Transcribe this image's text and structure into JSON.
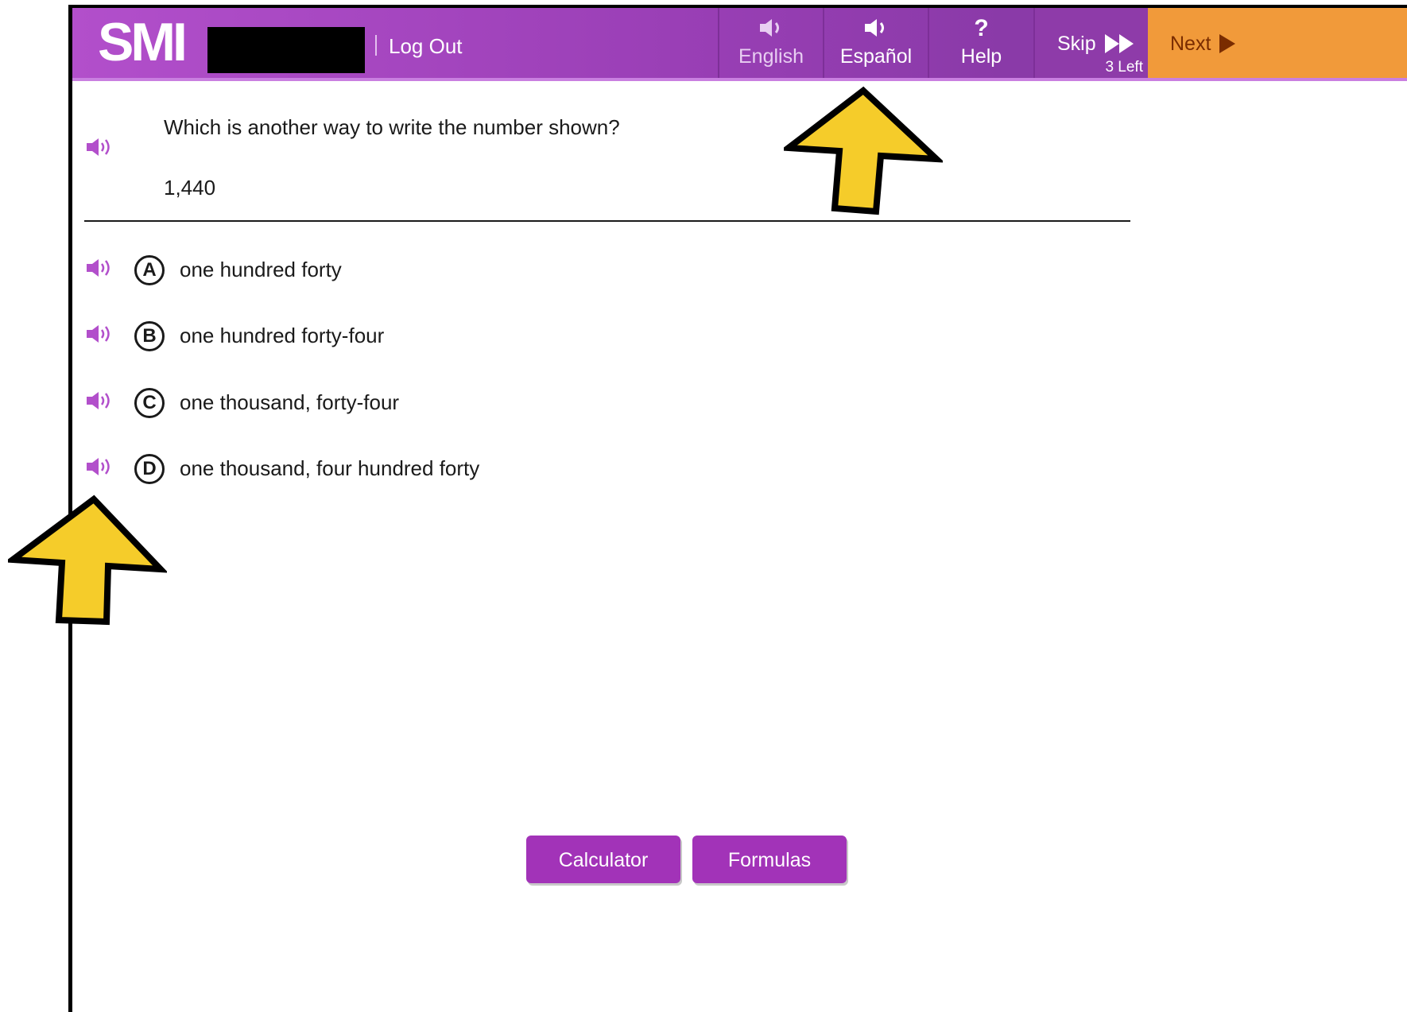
{
  "header": {
    "logo_text": "SMI",
    "logout_label": "Log Out",
    "english_label": "English",
    "espanol_label": "Español",
    "help_label": "Help",
    "skip_label": "Skip",
    "skip_remaining": "3 Left",
    "next_label": "Next"
  },
  "question": {
    "prompt": "Which is another way to write the number shown?",
    "number": "1,440"
  },
  "choices": [
    {
      "letter": "A",
      "text": "one hundred forty"
    },
    {
      "letter": "B",
      "text": "one hundred forty-four"
    },
    {
      "letter": "C",
      "text": "one thousand, forty-four"
    },
    {
      "letter": "D",
      "text": "one thousand, four hundred forty"
    }
  ],
  "footer": {
    "calculator_label": "Calculator",
    "formulas_label": "Formulas"
  },
  "icons": {
    "speaker": "speaker-icon",
    "help": "question-mark-icon",
    "skip": "fast-forward-icon",
    "next": "play-icon",
    "annotation": "arrow-up-icon"
  },
  "colors": {
    "header_purple": "#9a3fb6",
    "next_orange": "#f19a3a",
    "audio_purple": "#b24fcb",
    "button_purple": "#a233b8",
    "arrow_yellow": "#f5cc2a"
  }
}
